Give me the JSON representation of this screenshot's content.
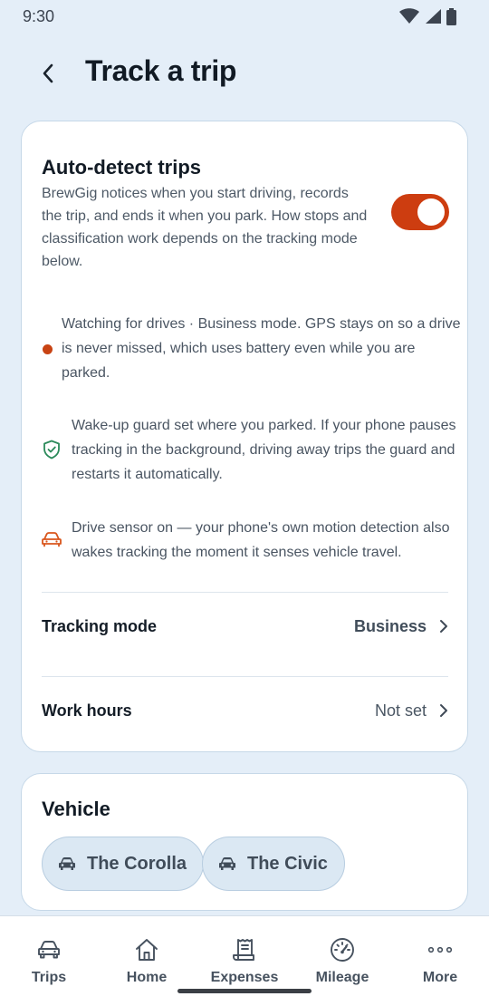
{
  "status_bar": {
    "time": "9:30",
    "icons": [
      "wifi-icon",
      "signal-icon",
      "battery-icon"
    ]
  },
  "header": {
    "back_icon": "chevron-left-icon",
    "title": "Track a trip"
  },
  "auto_detect": {
    "title": "Auto-detect trips",
    "description": "BrewGig notices when you start driving, records the trip, and ends it when you park. How stops and classification work depends on the tracking mode below.",
    "toggle_on": true,
    "toggle_color": "#cd3d10"
  },
  "info_items": [
    {
      "icon": "status-dot-icon",
      "text": "Watching for drives · Business mode. GPS stays on so a drive is never missed, which uses battery even while you are parked."
    },
    {
      "icon": "shield-check-icon",
      "text": "Wake-up guard set where you parked. If your phone pauses tracking in the background, driving away trips the guard and restarts it automatically."
    },
    {
      "icon": "car-icon",
      "text": "Drive sensor on — your phone's own motion detection also wakes tracking the moment it senses vehicle travel."
    }
  ],
  "settings": {
    "tracking_mode": {
      "label": "Tracking mode",
      "value": "Business"
    },
    "work_hours": {
      "label": "Work hours",
      "value": "Not set"
    }
  },
  "vehicle": {
    "title": "Vehicle",
    "options": [
      {
        "label": "The Corolla",
        "icon": "car-icon"
      },
      {
        "label": "The Civic",
        "icon": "car-icon"
      }
    ]
  },
  "bottom_nav": [
    {
      "label": "Trips",
      "icon": "car-outline-icon"
    },
    {
      "label": "Home",
      "icon": "home-icon"
    },
    {
      "label": "Expenses",
      "icon": "receipt-icon"
    },
    {
      "label": "Mileage",
      "icon": "speedometer-icon"
    },
    {
      "label": "More",
      "icon": "more-dots-icon"
    }
  ],
  "colors": {
    "accent": "#cd3d10",
    "background": "#e4eef8",
    "shield_green": "#2b8a5a",
    "car_orange": "#d9561c"
  }
}
